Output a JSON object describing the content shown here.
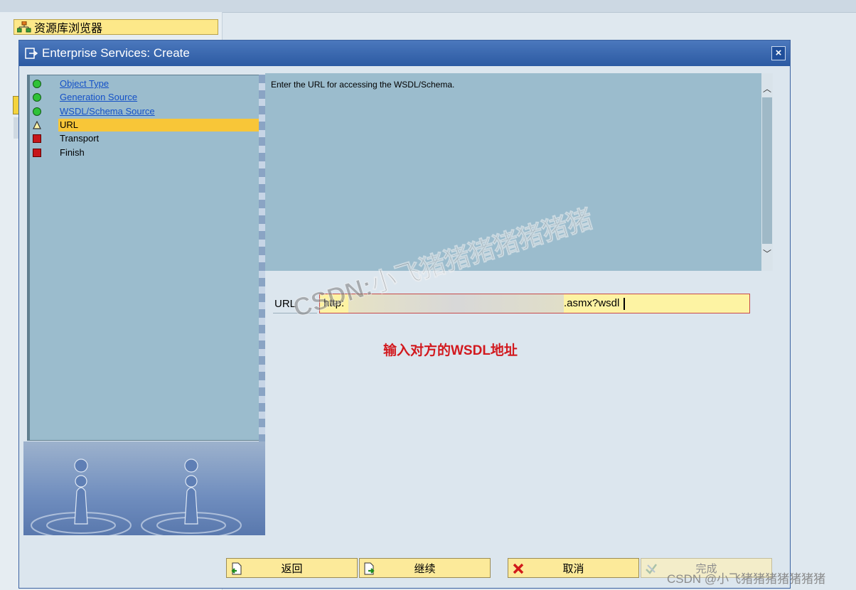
{
  "background": {
    "repo_button_label": "资源库浏览器"
  },
  "dialog": {
    "title": "Enterprise Services: Create",
    "close_label": "×"
  },
  "steps": [
    {
      "label": "Object Type",
      "state": "done"
    },
    {
      "label": "Generation Source",
      "state": "done"
    },
    {
      "label": "WSDL/Schema Source",
      "state": "done"
    },
    {
      "label": "URL",
      "state": "current"
    },
    {
      "label": "Transport",
      "state": "pending"
    },
    {
      "label": "Finish",
      "state": "pending"
    }
  ],
  "info": {
    "text": "Enter the URL for accessing the WSDL/Schema."
  },
  "url": {
    "label": "URL",
    "value_start": "http:",
    "value_end": ".asmx?wsdl"
  },
  "annotation": "输入对方的WSDL地址",
  "buttons": {
    "back": "返回",
    "continue": "继续",
    "cancel": "取消",
    "finish": "完成"
  },
  "watermarks": {
    "diagonal": "CSDN:小飞猪猪猪猪猪猪猪",
    "bottom": "CSDN @小飞猪猪猪猪猪猪猪"
  },
  "colors": {
    "title_bar": "#2c5aa2",
    "panel_blue": "#9bbccd",
    "current_step": "#f8c638",
    "annotation_red": "#d2191e"
  }
}
